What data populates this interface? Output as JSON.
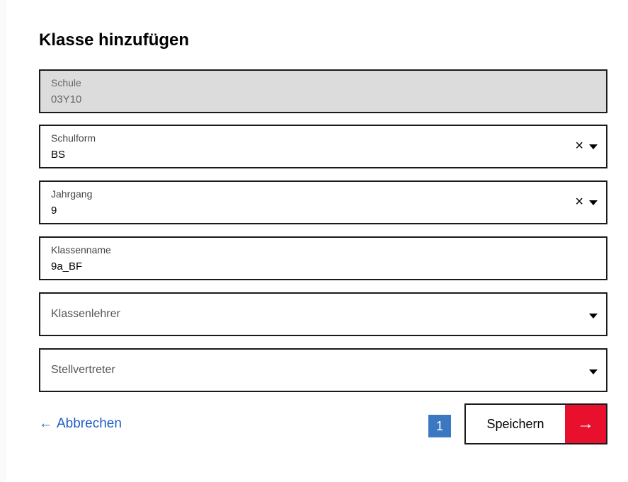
{
  "page": {
    "title": "Klasse hinzufügen"
  },
  "form": {
    "school": {
      "label": "Schule",
      "value": "03Y10"
    },
    "school_form": {
      "label": "Schulform",
      "value": "BS"
    },
    "grade": {
      "label": "Jahrgang",
      "value": "9"
    },
    "class_name": {
      "label": "Klassenname",
      "value": "9a_BF"
    },
    "class_teacher": {
      "placeholder": "Klassenlehrer"
    },
    "deputy": {
      "placeholder": "Stellvertreter"
    }
  },
  "icons": {
    "clear": "×",
    "back_arrow": "←",
    "save_arrow": "→"
  },
  "actions": {
    "cancel_label": "Abbrechen",
    "save_label": "Speichern",
    "step_badge": "1"
  },
  "colors": {
    "link": "#1f5ec6",
    "save_accent": "#e8102d",
    "badge": "#3c77c2",
    "disabled_field": "#dcdcdc"
  }
}
